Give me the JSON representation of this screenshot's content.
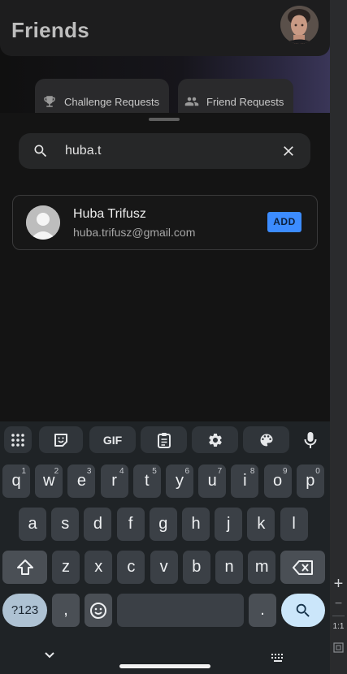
{
  "header": {
    "title": "Friends"
  },
  "tabs": [
    {
      "label": "Challenge Requests",
      "icon": "trophy-icon"
    },
    {
      "label": "Friend Requests",
      "icon": "people-icon"
    }
  ],
  "search": {
    "value": "huba.t",
    "clear_icon": "close-icon",
    "search_icon": "search-icon"
  },
  "result": {
    "name": "Huba Trifusz",
    "email": "huba.trifusz@gmail.com",
    "action_label": "ADD"
  },
  "keyboard": {
    "toolbar": [
      "apps-grid-icon",
      "sticker-icon",
      "GIF",
      "clipboard-icon",
      "settings-icon",
      "palette-icon",
      "mic-icon"
    ],
    "gif_label": "GIF",
    "row1": [
      "q",
      "w",
      "e",
      "r",
      "t",
      "y",
      "u",
      "i",
      "o",
      "p"
    ],
    "row1_digits": [
      "1",
      "2",
      "3",
      "4",
      "5",
      "6",
      "7",
      "8",
      "9",
      "0"
    ],
    "row2": [
      "a",
      "s",
      "d",
      "f",
      "g",
      "h",
      "j",
      "k",
      "l"
    ],
    "row3": [
      "z",
      "x",
      "c",
      "v",
      "b",
      "n",
      "m"
    ],
    "symbols_label": "?123",
    "comma": ",",
    "period": "."
  },
  "side_toolbar": {
    "zoom_in": "+",
    "zoom_out": "−",
    "ratio": "1:1"
  },
  "colors": {
    "accent": "#3c8cff",
    "background": "#141414",
    "keyboard": "#1f2326"
  }
}
